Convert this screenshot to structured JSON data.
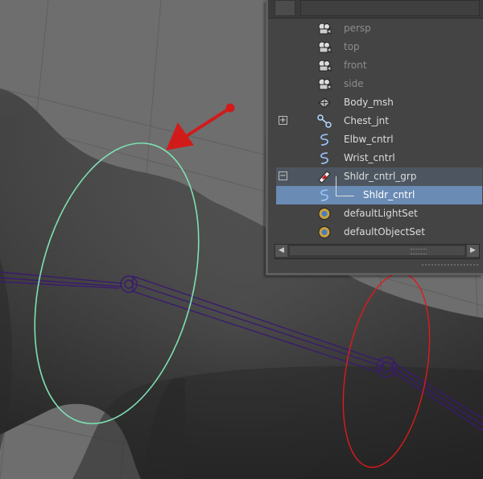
{
  "viewport": {
    "controls": [
      {
        "name": "Elbw_cntrl",
        "color": "#7ee0b2"
      },
      {
        "name": "Wrist_cntrl",
        "color": "#e01a1a"
      }
    ],
    "joint_color": "#3a1a6e",
    "annotation_arrow_color": "#d11b1b"
  },
  "outliner": {
    "items": [
      {
        "label": "persp",
        "icon": "camera-icon",
        "state": "dim"
      },
      {
        "label": "top",
        "icon": "camera-icon",
        "state": "dim"
      },
      {
        "label": "front",
        "icon": "camera-icon",
        "state": "dim"
      },
      {
        "label": "side",
        "icon": "camera-icon",
        "state": "dim"
      },
      {
        "label": "Body_msh",
        "icon": "mesh-icon",
        "state": "normal"
      },
      {
        "label": "Chest_jnt",
        "icon": "joint-icon",
        "state": "normal",
        "expand": "+"
      },
      {
        "label": "Elbw_cntrl",
        "icon": "curve-icon",
        "state": "normal"
      },
      {
        "label": "Wrist_cntrl",
        "icon": "curve-icon",
        "state": "normal"
      },
      {
        "label": "Shldr_cntrl_grp",
        "icon": "group-icon",
        "state": "group",
        "expand": "−"
      },
      {
        "label": "Shldr_cntrl",
        "icon": "curve-icon",
        "state": "selected",
        "child": true
      },
      {
        "label": "defaultLightSet",
        "icon": "set-icon",
        "state": "normal"
      },
      {
        "label": "defaultObjectSet",
        "icon": "set-icon",
        "state": "normal"
      }
    ],
    "selected_color": "#6a8bb4"
  }
}
